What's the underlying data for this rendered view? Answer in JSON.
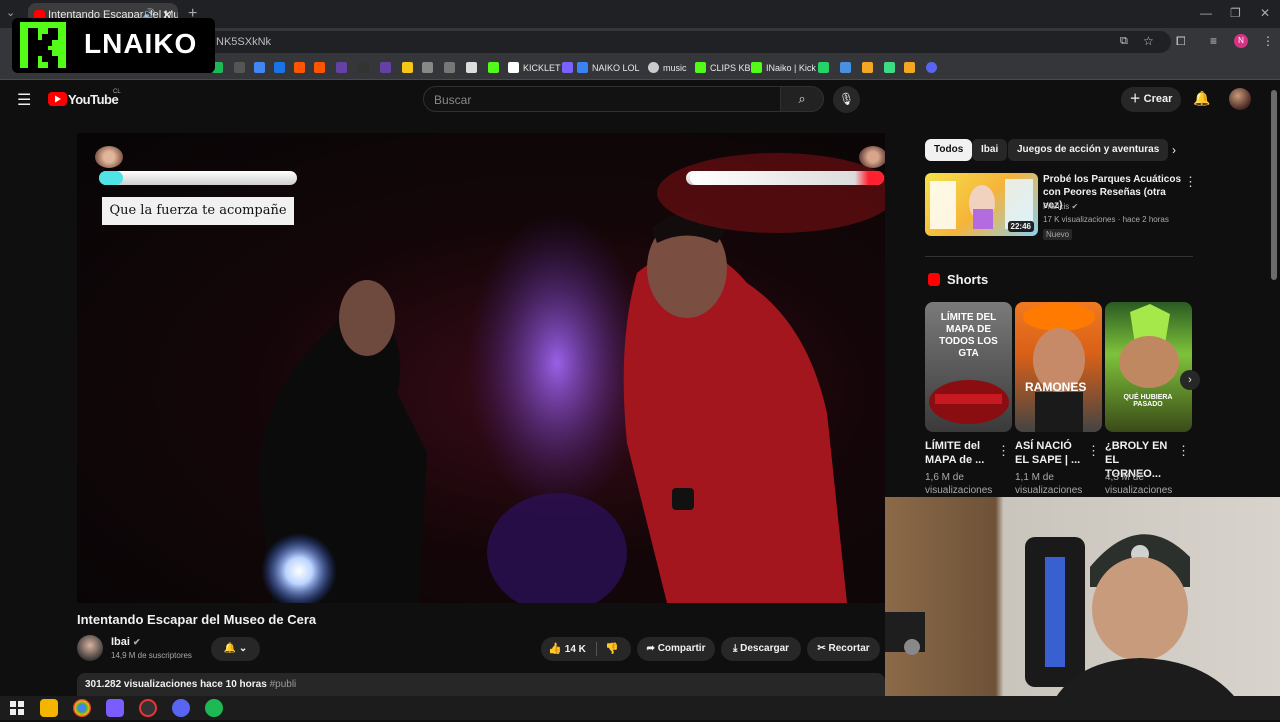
{
  "browser": {
    "tab_title": "Intentando Escapar del Mu",
    "address_fragment": "NK5SXkNk",
    "bookmarks": [
      "KICKLET",
      "NAIKO LOL",
      "music",
      "CLIPS KB",
      "INaiko | Kick"
    ]
  },
  "overlay": {
    "streamer_name": "LNAIKO"
  },
  "youtube": {
    "logo_text": "YouTube",
    "country_code": "CL",
    "search_placeholder": "Buscar",
    "create_label": "Crear"
  },
  "video": {
    "overlay_caption": "Que la fuerza te acompañe",
    "title": "Intentando Escapar del Museo de Cera",
    "channel": "Ibai",
    "subscribers": "14,9 M de suscriptores",
    "likes": "14 K",
    "actions": {
      "share": "Compartir",
      "download": "Descargar",
      "clip": "Recortar"
    },
    "views": "301.282 visualizaciones",
    "age": "hace 10 horas",
    "hashtag": "#publi",
    "player_health_fraction": 0.12,
    "opponent_health_fraction": 0.98
  },
  "sidebar": {
    "chips": [
      "Todos",
      "Ibai",
      "Juegos de acción y aventuras"
    ],
    "recommended": {
      "title_line1": "Probé los Parques Acuáticos",
      "title_line2": "con Peores Reseñas (otra vez)",
      "channel": "Francis",
      "meta": "17 K visualizaciones · hace 2 horas",
      "badge": "Nuevo",
      "duration": "22:46"
    },
    "shorts_heading": "Shorts",
    "shorts": [
      {
        "title_line1": "LÍMITE del",
        "title_line2": "MAPA de ...",
        "views_line1": "1,6 M de",
        "views_line2": "visualizaciones",
        "thumb_text": "LÍMITE DEL MAPA DE TODOS LOS GTA"
      },
      {
        "title_line1": "ASÍ NACIÓ",
        "title_line2": "EL SAPE | ...",
        "views_line1": "1,1 M de",
        "views_line2": "visualizaciones",
        "thumb_text": "RAMONES"
      },
      {
        "title_line1": "¿BROLY EN",
        "title_line2": "EL TORNEO...",
        "views_line1": "4,3 M de",
        "views_line2": "visualizaciones",
        "thumb_text": "QUÉ HUBIERA PASADO"
      }
    ]
  },
  "colors": {
    "kick_green": "#53fc18",
    "yt_red": "#ff0000",
    "bg": "#0f0f0f",
    "chip_bg": "#272727"
  }
}
